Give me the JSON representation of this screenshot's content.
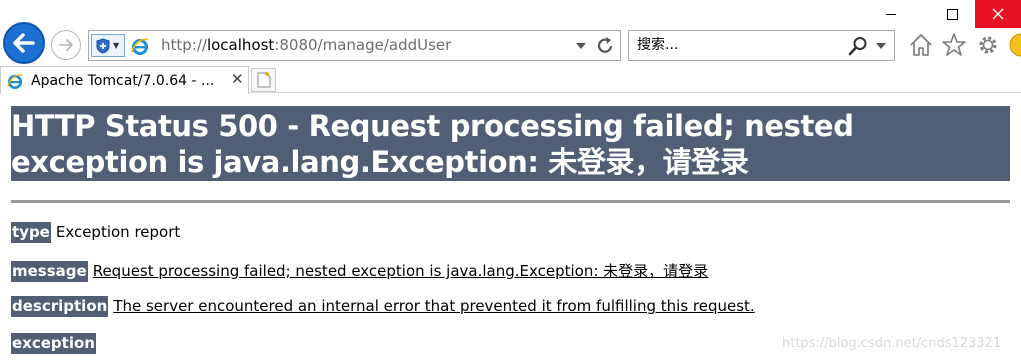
{
  "browser": {
    "address_bar": {
      "url_prefix": "http://",
      "url_host": "localhost",
      "url_rest": ":8080/manage/addUser"
    },
    "search_box": {
      "placeholder": "搜索..."
    },
    "tab": {
      "title": "Apache Tomcat/7.0.64 - ...",
      "close_glyph": "✕"
    }
  },
  "page": {
    "heading": "HTTP Status 500 - Request processing failed; nested exception is java.lang.Exception: 未登录，请登录",
    "rows": {
      "type": {
        "label": "type",
        "value": "Exception report"
      },
      "message": {
        "label": "message",
        "value": "Request processing failed; nested exception is java.lang.Exception: 未登录，请登录"
      },
      "description": {
        "label": "description",
        "value": "The server encountered an internal error that prevented it from fulfilling this request."
      },
      "exception": {
        "label": "exception"
      }
    },
    "watermark": "https://blog.csdn.net/cnds123321"
  },
  "colors": {
    "tomcat_header_bg": "#525d76",
    "close_button_bg": "#e81123",
    "back_button": "#1d6fd1"
  }
}
